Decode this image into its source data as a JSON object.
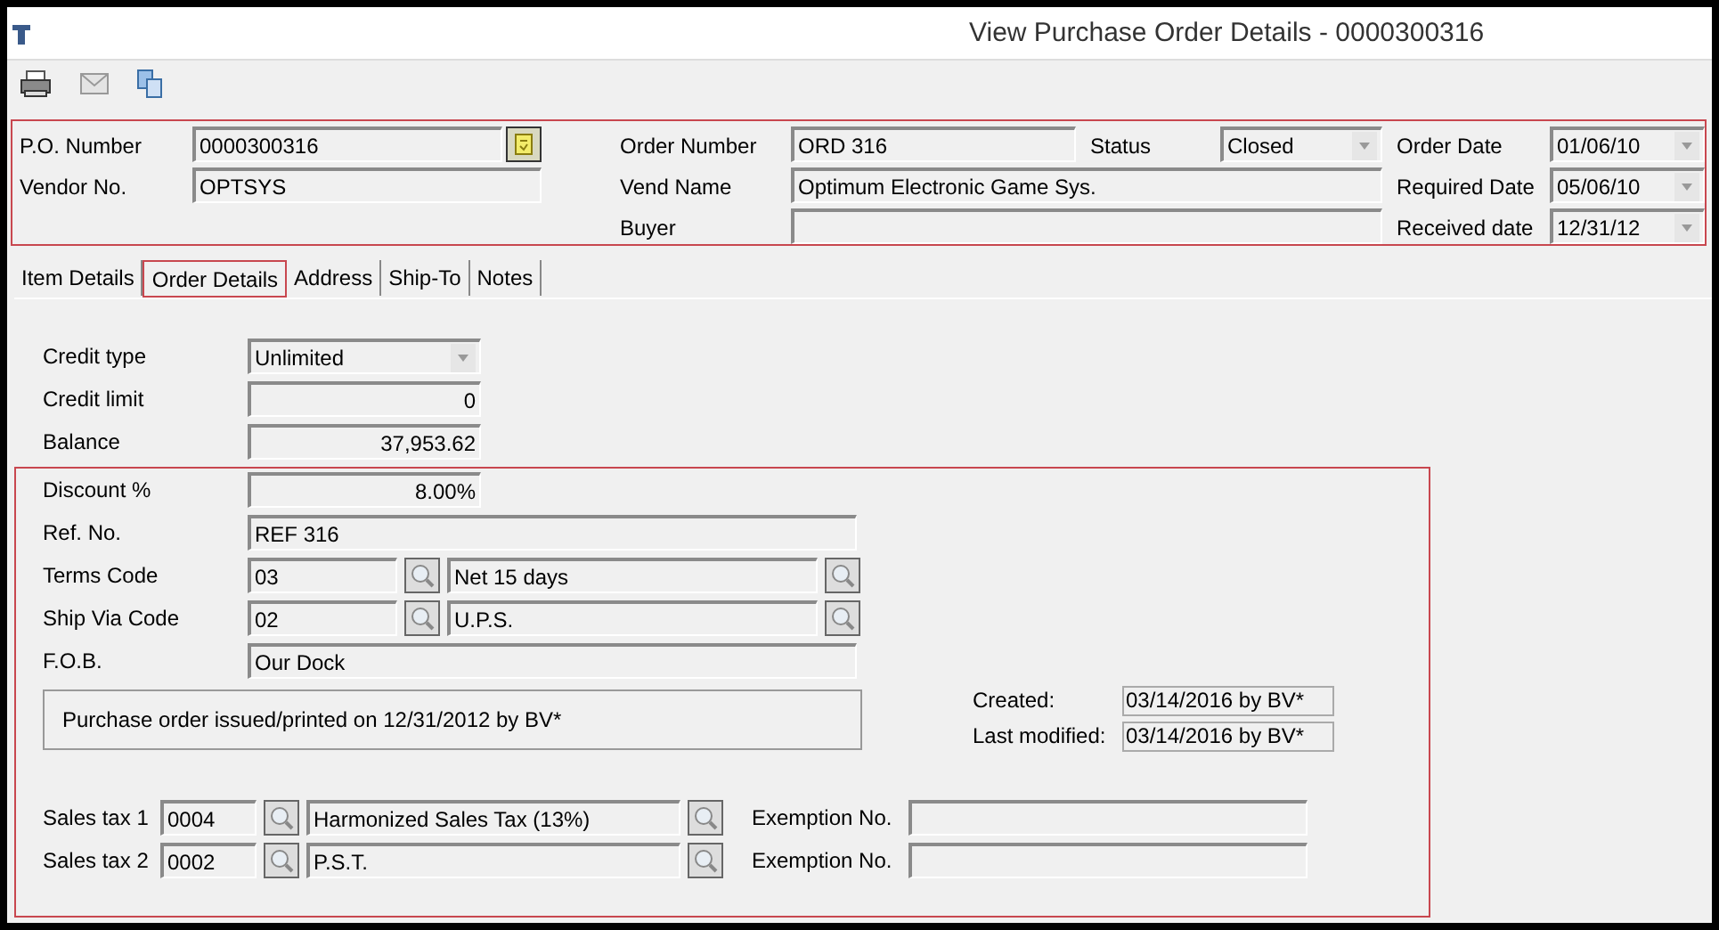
{
  "window": {
    "title": "View Purchase Order Details - 0000300316"
  },
  "header": {
    "po_number": {
      "label": "P.O. Number",
      "value": "0000300316"
    },
    "vendor_no": {
      "label": "Vendor No.",
      "value": "OPTSYS"
    },
    "order_number": {
      "label": "Order Number",
      "value": "ORD 316"
    },
    "vend_name": {
      "label": "Vend Name",
      "value": "Optimum Electronic Game Sys."
    },
    "buyer": {
      "label": "Buyer"
    },
    "status": {
      "label": "Status",
      "value": "Closed"
    },
    "order_date": {
      "label": "Order Date",
      "value": "01/06/10"
    },
    "required_date": {
      "label": "Required Date",
      "value": "05/06/10"
    },
    "received_date": {
      "label": "Received date",
      "value": "12/31/12"
    }
  },
  "tabs": [
    {
      "label": "Item Details",
      "selected": false
    },
    {
      "label": "Order Details",
      "selected": true
    },
    {
      "label": "Address",
      "selected": false
    },
    {
      "label": "Ship-To",
      "selected": false
    },
    {
      "label": "Notes",
      "selected": false
    }
  ],
  "order_details": {
    "credit_type": {
      "label": "Credit type",
      "value": "Unlimited"
    },
    "credit_limit": {
      "label": "Credit limit",
      "value": "0"
    },
    "balance": {
      "label": "Balance",
      "value": "37,953.62"
    },
    "discount": {
      "label": "Discount %",
      "value": "8.00%"
    },
    "ref_no": {
      "label": "Ref. No.",
      "value": "REF 316"
    },
    "lookups": [
      {
        "label": "Terms Code",
        "code": "03",
        "description": "Net 15 days"
      },
      {
        "label": "Ship Via Code",
        "code": "02",
        "description": "U.P.S."
      }
    ],
    "fob": {
      "label": "F.O.B.",
      "value": "Our Dock"
    },
    "note": "Purchase order issued/printed on 12/31/2012 by BV*",
    "created": {
      "label": "Created:",
      "value": "03/14/2016 by BV*"
    },
    "last_modified": {
      "label": "Last modified:",
      "value": "03/14/2016 by BV*"
    },
    "sales_taxes": [
      {
        "label": "Sales tax 1",
        "code": "0004",
        "description": "Harmonized Sales Tax (13%)",
        "exemption_label": "Exemption No."
      },
      {
        "label": "Sales tax 2",
        "code": "0002",
        "description": "P.S.T.",
        "exemption_label": "Exemption No."
      }
    ]
  }
}
